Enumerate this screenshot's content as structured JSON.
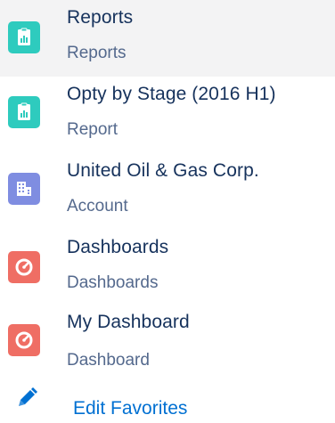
{
  "favorites": {
    "items": [
      {
        "title": "Reports",
        "subtitle": "Reports",
        "icon": "report-icon",
        "color": "#2ecbbe",
        "active": true
      },
      {
        "title": "Opty by Stage (2016 H1)",
        "subtitle": "Report",
        "icon": "report-icon",
        "color": "#2ecbbe",
        "active": false
      },
      {
        "title": "United Oil & Gas Corp.",
        "subtitle": "Account",
        "icon": "account-icon",
        "color": "#7f8de1",
        "active": false
      },
      {
        "title": "Dashboards",
        "subtitle": "Dashboards",
        "icon": "dashboard-icon",
        "color": "#ef6e64",
        "active": false
      },
      {
        "title": "My Dashboard",
        "subtitle": "Dashboard",
        "icon": "dashboard-icon",
        "color": "#ef6e64",
        "active": false
      }
    ],
    "edit_label": "Edit Favorites",
    "edit_icon": "pencil-icon",
    "accent_color": "#0070d2"
  }
}
